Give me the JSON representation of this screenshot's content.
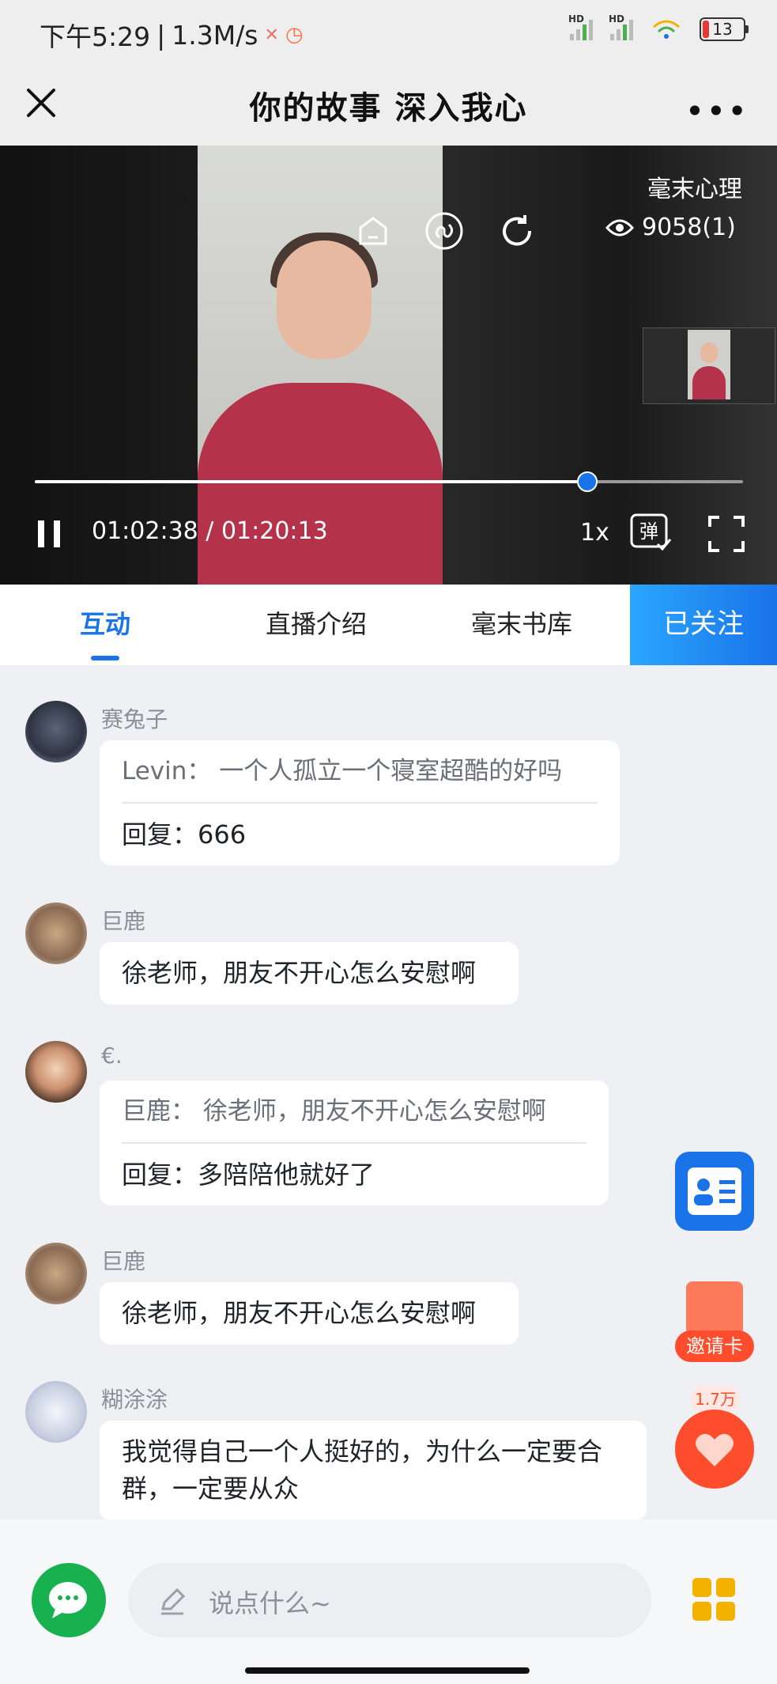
{
  "status_bar": {
    "time": "下午5:29",
    "speed": "1.3M/s",
    "sig1": "HD",
    "sig2": "HD",
    "battery": "13"
  },
  "header": {
    "title": "你的故事 深入我心"
  },
  "video": {
    "channel": "毫末心理",
    "views": "9058(1)",
    "current_time": "01:02:38",
    "total_time": "01:20:13",
    "progress": 0.78,
    "speed": "1x",
    "danmu_label": "弹"
  },
  "tabs": [
    {
      "label": "互动",
      "active": true
    },
    {
      "label": "直播介绍",
      "active": false
    },
    {
      "label": "毫末书库",
      "active": false
    }
  ],
  "follow_label": "已关注",
  "messages": [
    {
      "user": "赛兔子",
      "quote_user": "Levin：",
      "quote_text": "一个人孤立一个寝室超酷的好吗",
      "reply": "回复：666"
    },
    {
      "user": "巨鹿",
      "text": "徐老师，朋友不开心怎么安慰啊"
    },
    {
      "user": "€.",
      "quote_user": "巨鹿：",
      "quote_text": "徐老师，朋友不开心怎么安慰啊",
      "reply": "回复：多陪陪他就好了"
    },
    {
      "user": "巨鹿",
      "text": "徐老师，朋友不开心怎么安慰啊"
    },
    {
      "user": "糊涂涂",
      "text": "我觉得自己一个人挺好的，为什么一定要合群，一定要从众"
    }
  ],
  "side": {
    "invite_label": "邀请卡",
    "likes": "1.7万"
  },
  "input": {
    "placeholder": "说点什么~"
  },
  "colors": {
    "accent": "#1a73e8",
    "like": "#ff4d2e",
    "wechat": "#17b24f"
  }
}
